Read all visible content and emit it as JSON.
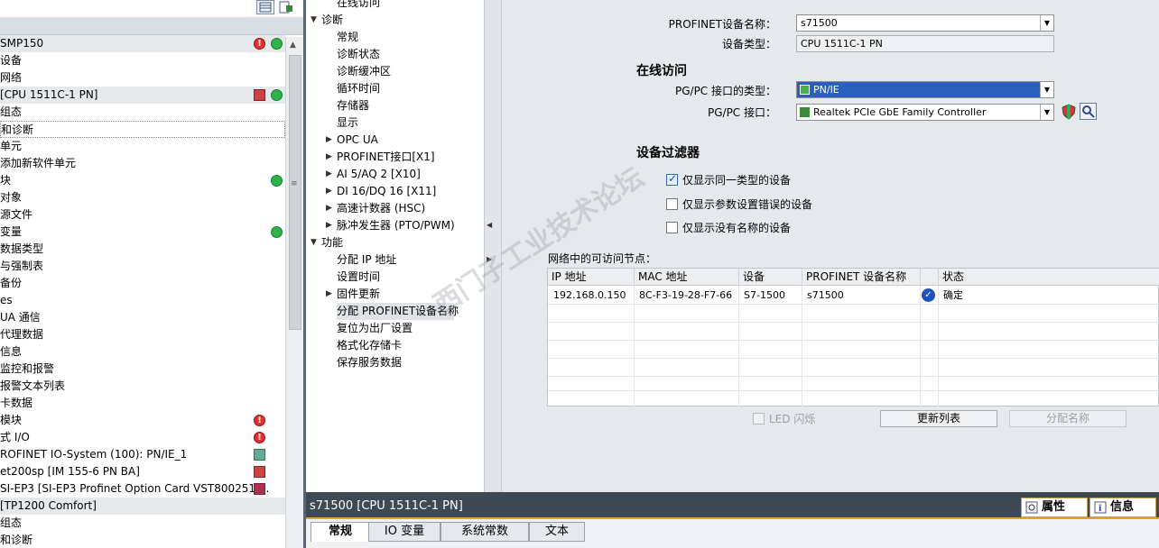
{
  "project_tree": {
    "items": [
      {
        "label": "SMP150",
        "status": [
          "error",
          "ok"
        ],
        "header": true
      },
      {
        "label": "设备"
      },
      {
        "label": "网络"
      },
      {
        "label": "[CPU 1511C-1 PN]",
        "status": [
          "device",
          "ok"
        ],
        "header": true
      },
      {
        "label": "组态"
      },
      {
        "label": "和诊断",
        "selected": true
      },
      {
        "label": "单元"
      },
      {
        "label": "添加新软件单元"
      },
      {
        "label": "块",
        "status": [
          "none",
          "ok"
        ]
      },
      {
        "label": "对象"
      },
      {
        "label": "源文件"
      },
      {
        "label": "变量",
        "status": [
          "none",
          "ok"
        ]
      },
      {
        "label": "数据类型"
      },
      {
        "label": "与强制表"
      },
      {
        "label": "备份"
      },
      {
        "label": "es"
      },
      {
        "label": "UA 通信"
      },
      {
        "label": "代理数据"
      },
      {
        "label": "信息"
      },
      {
        "label": "监控和报警"
      },
      {
        "label": "报警文本列表"
      },
      {
        "label": "卡数据"
      },
      {
        "label": "模块",
        "status": [
          "error"
        ]
      },
      {
        "label": "式 I/O",
        "status": [
          "error"
        ]
      },
      {
        "label": "ROFINET IO-System (100): PN/IE_1",
        "status": [
          "device-ok"
        ]
      },
      {
        "label": "et200sp [IM 155-6 PN BA]",
        "status": [
          "device"
        ]
      },
      {
        "label": "SI-EP3 [SI-EP3 Profinet Option Card VST800251 ...",
        "status": [
          "device-warn"
        ]
      },
      {
        "label": "[TP1200 Comfort]",
        "header": true
      },
      {
        "label": "组态"
      },
      {
        "label": "和诊断"
      }
    ]
  },
  "nav": {
    "items": [
      {
        "label": "在线访问",
        "level": 1
      },
      {
        "label": "诊断",
        "level": 0,
        "expanded": true
      },
      {
        "label": "常规",
        "level": 1
      },
      {
        "label": "诊断状态",
        "level": 1
      },
      {
        "label": "诊断缓冲区",
        "level": 1
      },
      {
        "label": "循环时间",
        "level": 1
      },
      {
        "label": "存储器",
        "level": 1
      },
      {
        "label": "显示",
        "level": 1
      },
      {
        "label": "OPC UA",
        "level": 1,
        "collapsed": true
      },
      {
        "label": "PROFINET接口[X1]",
        "level": 1,
        "collapsed": true
      },
      {
        "label": "AI 5/AQ 2 [X10]",
        "level": 1,
        "collapsed": true
      },
      {
        "label": "DI 16/DQ 16 [X11]",
        "level": 1,
        "collapsed": true
      },
      {
        "label": "高速计数器 (HSC)",
        "level": 1,
        "collapsed": true
      },
      {
        "label": "脉冲发生器 (PTO/PWM)",
        "level": 1,
        "collapsed": true
      },
      {
        "label": "功能",
        "level": 0,
        "expanded": true
      },
      {
        "label": "分配 IP 地址",
        "level": 1
      },
      {
        "label": "设置时间",
        "level": 1
      },
      {
        "label": "固件更新",
        "level": 1,
        "collapsed": true
      },
      {
        "label": "分配 PROFINET设备名称",
        "level": 1,
        "selected": true
      },
      {
        "label": "复位为出厂设置",
        "level": 1
      },
      {
        "label": "格式化存储卡",
        "level": 1
      },
      {
        "label": "保存服务数据",
        "level": 1
      }
    ]
  },
  "config": {
    "device_name_label": "PROFINET设备名称：",
    "device_name_value": "s71500",
    "device_type_label": "设备类型：",
    "device_type_value": "CPU 1511C-1 PN",
    "online_access_title": "在线访问",
    "pgpc_type_label": "PG/PC 接口的类型：",
    "pgpc_type_value": "PN/IE",
    "pgpc_if_label": "PG/PC 接口：",
    "pgpc_if_value": "Realtek PCIe GbE Family Controller",
    "filter_title": "设备过滤器",
    "filter_same_type": "仅显示同一类型的设备",
    "filter_param_err": "仅显示参数设置错误的设备",
    "filter_no_name": "仅显示没有名称的设备",
    "nodes_label": "网络中的可访问节点："
  },
  "table": {
    "headers": [
      "IP 地址",
      "MAC 地址",
      "设备",
      "PROFINET 设备名称",
      "状态"
    ],
    "rows": [
      {
        "ip": "192.168.0.150",
        "mac": "8C-F3-19-28-F7-66",
        "device": "S7-1500",
        "name": "s71500",
        "status": "确定"
      }
    ]
  },
  "actions": {
    "led_flash": "LED 闪烁",
    "refresh": "更新列表",
    "assign": "分配名称"
  },
  "inspector": {
    "title": "s71500 [CPU 1511C-1 PN]",
    "tabs": [
      "常规",
      "IO 变量",
      "系统常数",
      "文本"
    ],
    "right_tabs": [
      "属性",
      "信息"
    ]
  },
  "colors": {
    "accent": "#e8a02c",
    "selection_blue": "#2b5fbd",
    "ok_green": "#2fb24a",
    "error_red": "#e03131"
  }
}
